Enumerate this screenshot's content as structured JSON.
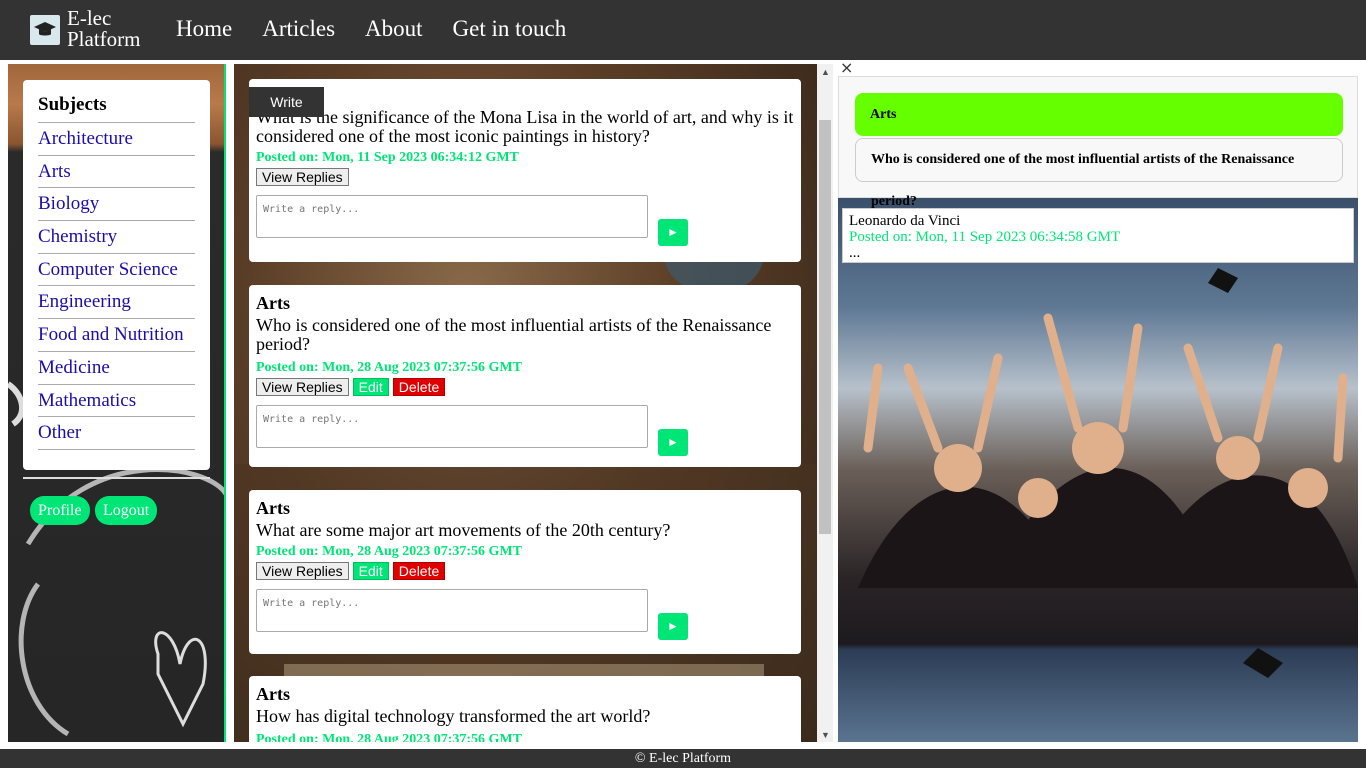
{
  "header": {
    "brand_line1": "E-lec",
    "brand_line2": "Platform",
    "nav": [
      "Home",
      "Articles",
      "About",
      "Get in touch"
    ]
  },
  "sidebar": {
    "title": "Subjects",
    "subjects": [
      "Architecture",
      "Arts",
      "Biology",
      "Chemistry",
      "Computer Science",
      "Engineering",
      "Food and Nutrition",
      "Medicine",
      "Mathematics",
      "Other"
    ],
    "profile_label": "Profile",
    "logout_label": "Logout"
  },
  "feed": {
    "write_label": "Write",
    "view_replies_label": "View Replies",
    "edit_label": "Edit",
    "delete_label": "Delete",
    "reply_placeholder": "Write a reply...",
    "send_icon": "send-icon",
    "posts": [
      {
        "subject": "",
        "question": "What is the significance of the Mona Lisa in the world of art, and why is it considered one of the most iconic paintings in history?",
        "date": "Posted on: Mon, 11 Sep 2023 06:34:12 GMT"
      },
      {
        "subject": "Arts",
        "question": "Who is considered one of the most influential artists of the Renaissance period?",
        "date": "Posted on: Mon, 28 Aug 2023 07:37:56 GMT"
      },
      {
        "subject": "Arts",
        "question": "What are some major art movements of the 20th century?",
        "date": "Posted on: Mon, 28 Aug 2023 07:37:56 GMT"
      },
      {
        "subject": "Arts",
        "question": "How has digital technology transformed the art world?",
        "date": "Posted on: Mon, 28 Aug 2023 07:37:56 GMT"
      }
    ]
  },
  "detail": {
    "close_label": "×",
    "subject": "Arts",
    "question": "Who is considered one of the most influential artists of the Renaissance period?",
    "reply_author": "Leonardo da Vinci",
    "reply_date": "Posted on: Mon, 11 Sep 2023 06:34:58 GMT",
    "reply_more": "..."
  },
  "footer": {
    "text": "© E-lec Platform"
  },
  "colors": {
    "accent": "#00e676",
    "subject_highlight": "#66ff00",
    "danger": "#e00000",
    "bar": "#333333"
  }
}
